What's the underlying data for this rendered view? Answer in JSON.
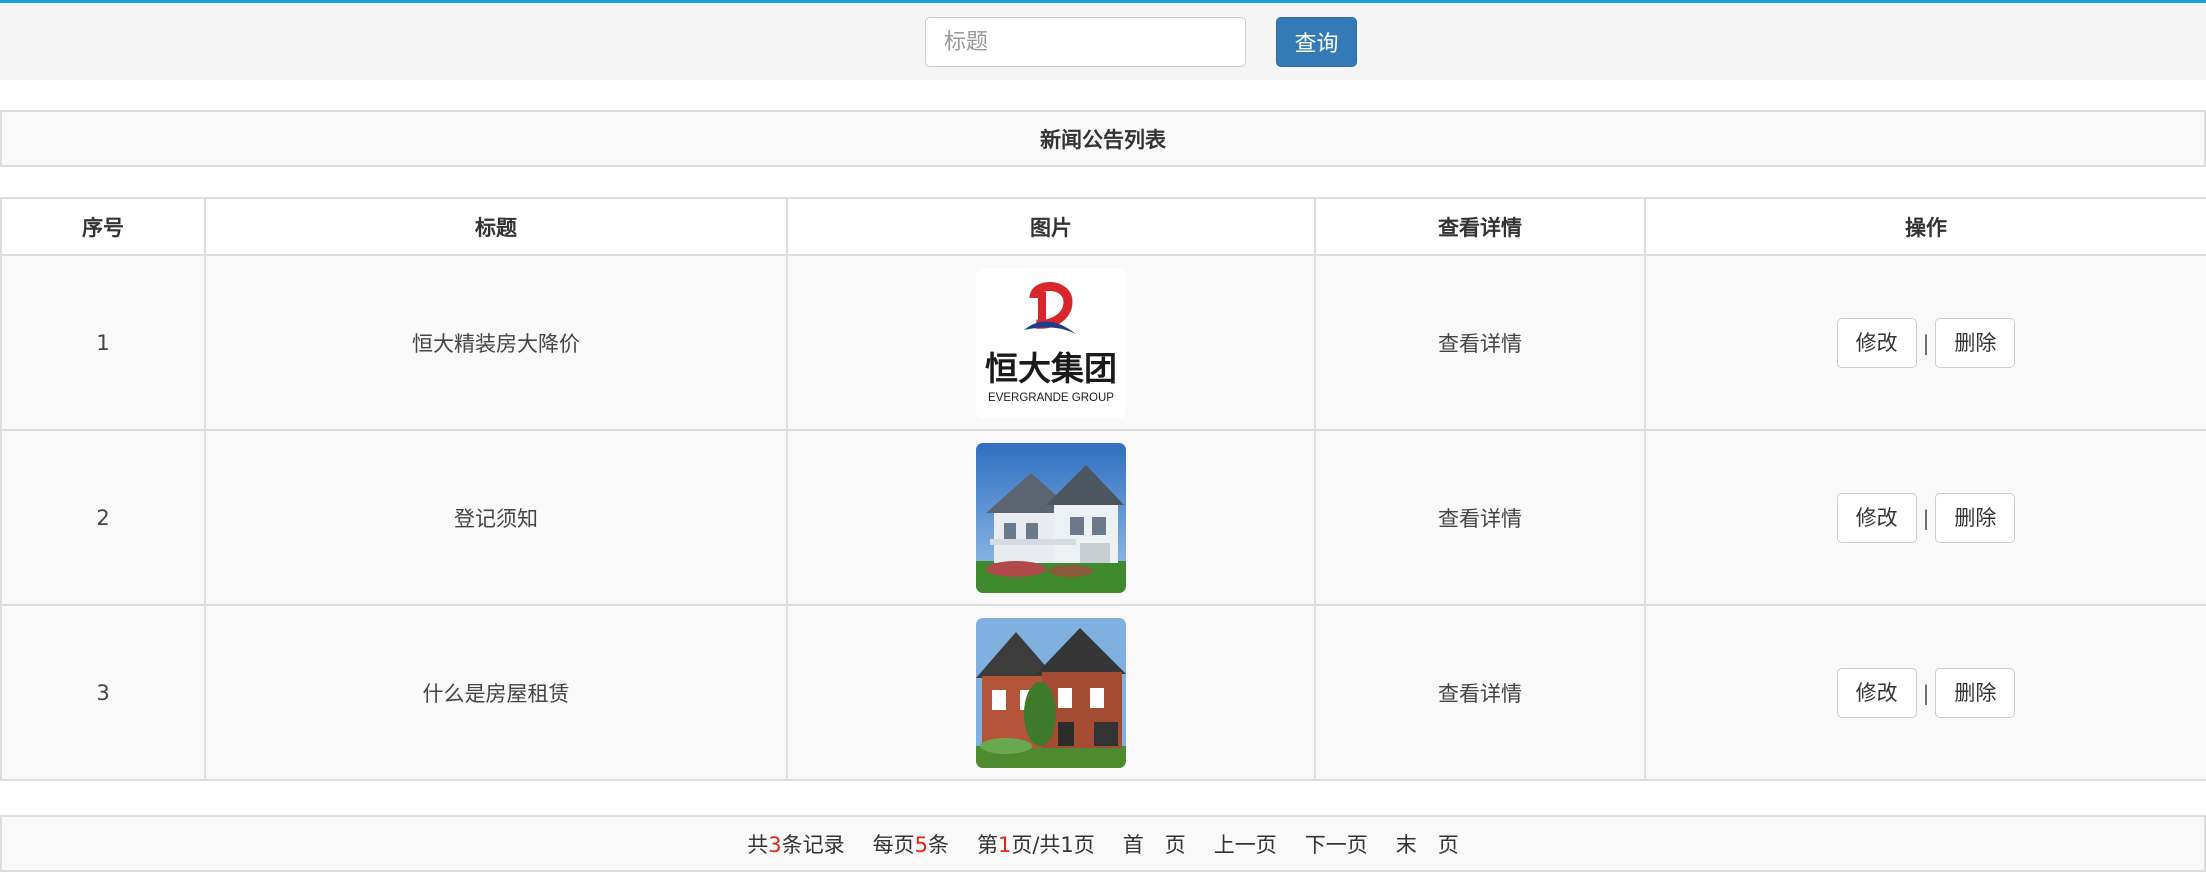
{
  "search": {
    "placeholder": "标题",
    "button_label": "查询"
  },
  "list_title": "新闻公告列表",
  "table": {
    "headers": [
      "序号",
      "标题",
      "图片",
      "查看详情",
      "操作"
    ],
    "rows": [
      {
        "index": "1",
        "title": "恒大精装房大降价",
        "image": "evergrande-logo",
        "logo_cn": "恒大集团",
        "logo_en": "EVERGRANDE GROUP",
        "detail": "查看详情",
        "edit": "修改",
        "sep": "|",
        "delete": "删除"
      },
      {
        "index": "2",
        "title": "登记须知",
        "image": "house-white-photo",
        "detail": "查看详情",
        "edit": "修改",
        "sep": "|",
        "delete": "删除"
      },
      {
        "index": "3",
        "title": "什么是房屋租赁",
        "image": "house-brick-photo",
        "detail": "查看详情",
        "edit": "修改",
        "sep": "|",
        "delete": "删除"
      }
    ]
  },
  "pager": {
    "total_prefix": "共",
    "total": "3",
    "total_suffix": "条记录",
    "per_page_prefix": "每页",
    "per_page": "5",
    "per_page_suffix": "条",
    "page_prefix": "第",
    "page": "1",
    "page_suffix": "页/共1页",
    "first": "首　页",
    "prev": "上一页",
    "next": "下一页",
    "last": "末　页"
  },
  "colors": {
    "accent": "#1e9fd8",
    "primary_button": "#337ab7",
    "highlight_number": "#e0251b"
  }
}
